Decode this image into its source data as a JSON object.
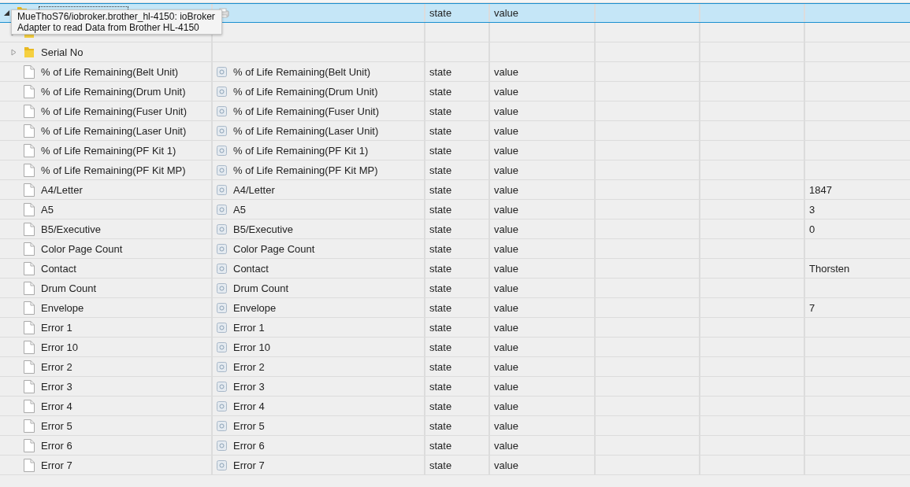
{
  "tooltip": {
    "lines": [
      "MueThoS76/iobroker.brother_hl-4150: ioBroker",
      "Adapter to read Data from Brother HL-4150"
    ]
  },
  "tree": [
    {
      "kind": "adapter",
      "expanded": true,
      "selected": true,
      "type": "state",
      "role": "value",
      "children": [
        {
          "kind": "folder",
          "expanded": false,
          "selected": false
        },
        {
          "kind": "folder",
          "expanded": false,
          "selected": false,
          "name": "Serial No"
        },
        {
          "kind": "state",
          "selected": false,
          "name": "% of Life Remaining(Belt Unit)",
          "title": "% of Life Remaining(Belt Unit)",
          "type": "state",
          "role": "value"
        },
        {
          "kind": "state",
          "selected": false,
          "name": "% of Life Remaining(Drum Unit)",
          "title": "% of Life Remaining(Drum Unit)",
          "type": "state",
          "role": "value"
        },
        {
          "kind": "state",
          "selected": false,
          "name": "% of Life Remaining(Fuser Unit)",
          "title": "% of Life Remaining(Fuser Unit)",
          "type": "state",
          "role": "value"
        },
        {
          "kind": "state",
          "selected": false,
          "name": "% of Life Remaining(Laser Unit)",
          "title": "% of Life Remaining(Laser Unit)",
          "type": "state",
          "role": "value"
        },
        {
          "kind": "state",
          "selected": false,
          "name": "% of Life Remaining(PF Kit 1)",
          "title": "% of Life Remaining(PF Kit 1)",
          "type": "state",
          "role": "value"
        },
        {
          "kind": "state",
          "selected": false,
          "name": "% of Life Remaining(PF Kit MP)",
          "title": "% of Life Remaining(PF Kit MP)",
          "type": "state",
          "role": "value"
        },
        {
          "kind": "state",
          "selected": false,
          "name": "A4/Letter",
          "title": "A4/Letter",
          "type": "state",
          "role": "value",
          "value": "1847"
        },
        {
          "kind": "state",
          "selected": false,
          "name": "A5",
          "title": "A5",
          "type": "state",
          "role": "value",
          "value": "3"
        },
        {
          "kind": "state",
          "selected": false,
          "name": "B5/Executive",
          "title": "B5/Executive",
          "type": "state",
          "role": "value",
          "value": "0"
        },
        {
          "kind": "state",
          "selected": false,
          "name": "Color Page Count",
          "title": "Color Page Count",
          "type": "state",
          "role": "value"
        },
        {
          "kind": "state",
          "selected": false,
          "name": "Contact",
          "title": "Contact",
          "type": "state",
          "role": "value",
          "value": "Thorsten"
        },
        {
          "kind": "state",
          "selected": false,
          "name": "Drum Count",
          "title": "Drum Count",
          "type": "state",
          "role": "value"
        },
        {
          "kind": "state",
          "selected": false,
          "name": "Envelope",
          "title": "Envelope",
          "type": "state",
          "role": "value",
          "value": "7"
        },
        {
          "kind": "state",
          "selected": false,
          "name": "Error 1",
          "title": "Error 1",
          "type": "state",
          "role": "value"
        },
        {
          "kind": "state",
          "selected": false,
          "name": "Error 10",
          "title": "Error 10",
          "type": "state",
          "role": "value"
        },
        {
          "kind": "state",
          "selected": false,
          "name": "Error 2",
          "title": "Error 2",
          "type": "state",
          "role": "value"
        },
        {
          "kind": "state",
          "selected": false,
          "name": "Error 3",
          "title": "Error 3",
          "type": "state",
          "role": "value"
        },
        {
          "kind": "state",
          "selected": false,
          "name": "Error 4",
          "title": "Error 4",
          "type": "state",
          "role": "value"
        },
        {
          "kind": "state",
          "selected": false,
          "name": "Error 5",
          "title": "Error 5",
          "type": "state",
          "role": "value"
        },
        {
          "kind": "state",
          "selected": false,
          "name": "Error 6",
          "title": "Error 6",
          "type": "state",
          "role": "value"
        },
        {
          "kind": "state",
          "selected": false,
          "name": "Error 7",
          "title": "Error 7",
          "type": "state",
          "role": "value"
        }
      ]
    }
  ]
}
